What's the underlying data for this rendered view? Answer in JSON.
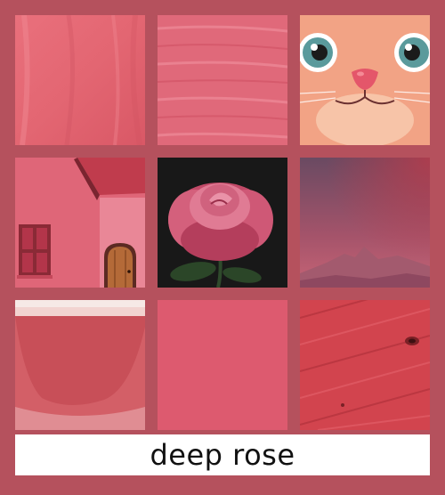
{
  "caption": {
    "text": "deep rose"
  },
  "colors": {
    "frame": "#b5515d",
    "swatch": "#dd5a6f",
    "caption_bg": "#ffffff",
    "caption_text": "#111111"
  },
  "tiles": [
    {
      "name": "fabric-texture"
    },
    {
      "name": "brush-stroke-texture"
    },
    {
      "name": "cartoon-cat-face"
    },
    {
      "name": "pink-house-painting"
    },
    {
      "name": "rose-flower-photo"
    },
    {
      "name": "misty-mountain-landscape"
    },
    {
      "name": "ceramic-cup-closeup"
    },
    {
      "name": "solid-color-swatch"
    },
    {
      "name": "wood-grain-texture"
    }
  ]
}
